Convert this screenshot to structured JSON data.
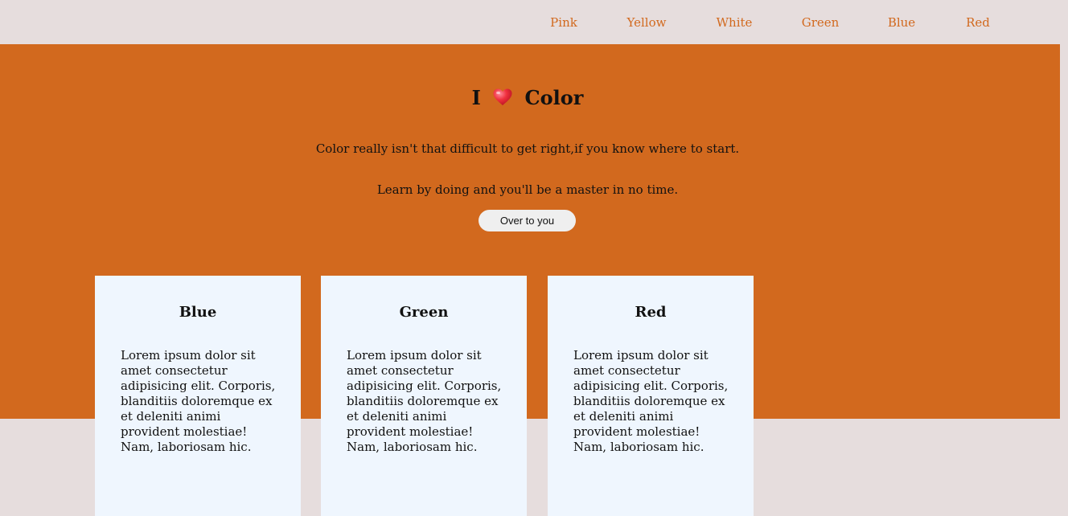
{
  "nav": {
    "items": [
      "Pink",
      "Yellow",
      "White",
      "Green",
      "Blue",
      "Red"
    ]
  },
  "hero": {
    "title_before": "I",
    "title_after": "Color",
    "heart_icon": "red-heart-icon",
    "line1": "Color really isn't that difficult to get right,if you know where to start.",
    "line2": "Learn by doing and you'll be a master in no time.",
    "button_label": "Over to you"
  },
  "cards": [
    {
      "title": "Blue",
      "body": "Lorem ipsum dolor sit amet consectetur adipisicing elit. Corporis, blanditiis doloremque ex et deleniti animi provident molestiae! Nam, laboriosam hic."
    },
    {
      "title": "Green",
      "body": "Lorem ipsum dolor sit amet consectetur adipisicing elit. Corporis, blanditiis doloremque ex et deleniti animi provident molestiae! Nam, laboriosam hic."
    },
    {
      "title": "Red",
      "body": "Lorem ipsum dolor sit amet consectetur adipisicing elit. Corporis, blanditiis doloremque ex et deleniti animi provident molestiae! Nam, laboriosam hic."
    }
  ],
  "colors": {
    "accent": "#d2691e",
    "page_background": "#e6dddd",
    "card_background": "#eff6fe",
    "button_background": "#efefef"
  }
}
